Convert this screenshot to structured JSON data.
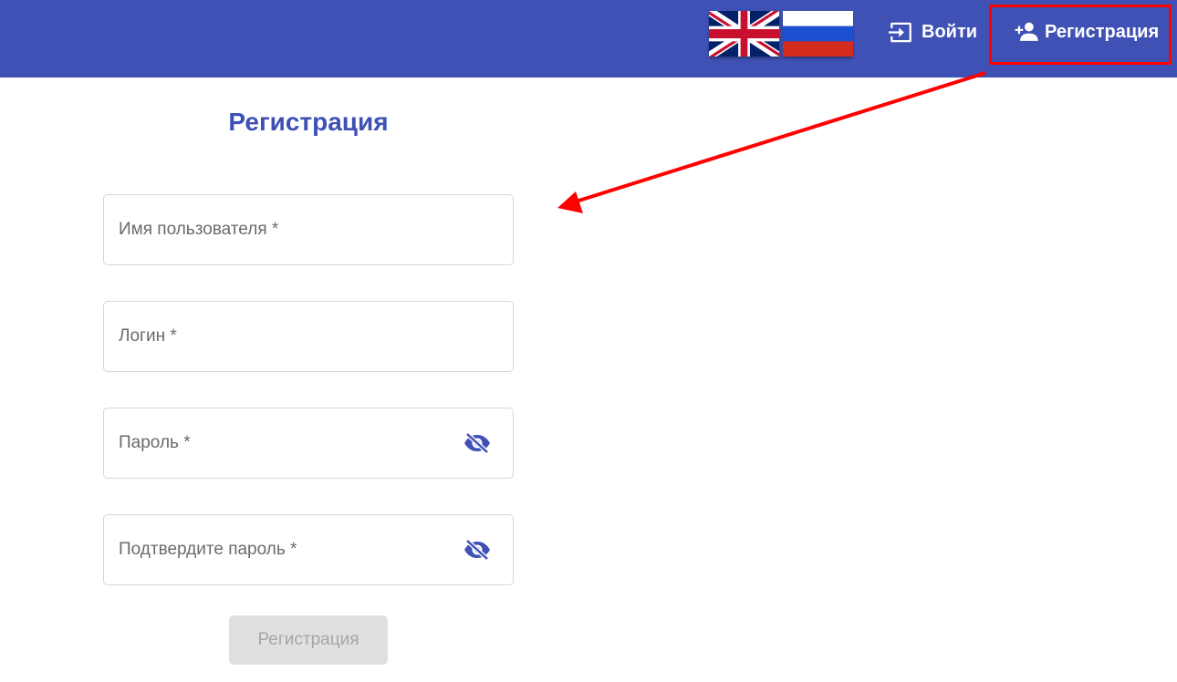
{
  "header": {
    "background": "#3f51b5",
    "languages": [
      {
        "code": "en",
        "icon": "uk-flag-icon"
      },
      {
        "code": "ru",
        "icon": "russia-flag-icon"
      }
    ],
    "login_label": "Войти",
    "login_icon": "login-icon",
    "register_label": "Регистрация",
    "register_icon": "person-add-icon"
  },
  "annotation": {
    "color": "#ff0000",
    "description": "red highlight box on register nav button with arrow pointing to form"
  },
  "form": {
    "title": "Регистрация",
    "fields": [
      {
        "label": "Имя пользователя *",
        "type": "text"
      },
      {
        "label": "Логин *",
        "type": "text"
      },
      {
        "label": "Пароль *",
        "type": "password",
        "icon": "visibility-off-icon"
      },
      {
        "label": "Подтвердите пароль *",
        "type": "password",
        "icon": "visibility-off-icon"
      }
    ],
    "submit_label": "Регистрация",
    "submit_state": "disabled"
  }
}
